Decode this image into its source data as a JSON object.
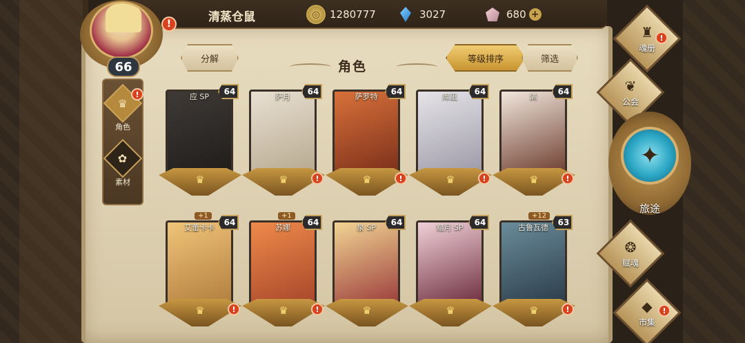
{
  "player": {
    "name": "清蒸仓鼠",
    "level": "66"
  },
  "resources": [
    {
      "icon": "coin-icon",
      "value": "1280777"
    },
    {
      "icon": "crystal-icon",
      "value": "3027"
    },
    {
      "icon": "rose-gem-icon",
      "value": "680"
    }
  ],
  "left_tabs": [
    {
      "label": "角色",
      "icon": "character-icon",
      "active": true
    },
    {
      "label": "素材",
      "icon": "material-icon",
      "active": false
    }
  ],
  "header": {
    "decompose_label": "分解",
    "title": "角色",
    "sort_label": "等级排序",
    "filter_label": "筛选"
  },
  "cards_row1": [
    {
      "name": "应 SP",
      "level": "64",
      "colors": [
        "#3f3a36",
        "#1f1c1a"
      ]
    },
    {
      "name": "萨月",
      "level": "64",
      "colors": [
        "#e9e0d2",
        "#b6a88e"
      ]
    },
    {
      "name": "萨罗特",
      "level": "64",
      "colors": [
        "#d8713a",
        "#7a2e1a"
      ]
    },
    {
      "name": "库凪",
      "level": "64",
      "colors": [
        "#e6e4e8",
        "#9b98a6"
      ]
    },
    {
      "name": "满",
      "level": "64",
      "colors": [
        "#f1e6dc",
        "#6b3b2c"
      ]
    }
  ],
  "cards_row2": [
    {
      "name": "艾蕾卡卡",
      "level": "64",
      "plus": "+1",
      "colors": [
        "#f0c47a",
        "#b07d3c"
      ]
    },
    {
      "name": "苏娜",
      "level": "64",
      "plus": "+1",
      "colors": [
        "#ef8a4a",
        "#a5452a"
      ]
    },
    {
      "name": "泉 SP",
      "level": "64",
      "plus": "",
      "colors": [
        "#f1d493",
        "#9a3a3a"
      ]
    },
    {
      "name": "黯月 SP",
      "level": "64",
      "plus": "",
      "colors": [
        "#f0d0d8",
        "#6b2b3d"
      ]
    },
    {
      "name": "古鲁瓦德",
      "level": "63",
      "plus": "+12",
      "colors": [
        "#6a8c9a",
        "#2a3a48"
      ]
    }
  ],
  "right_nav": {
    "soul_book": "魂册",
    "guild": "公会",
    "journey": "旅途",
    "talent": "赋魂",
    "market": "市集"
  },
  "colors": {
    "accent_gold": "#c89531",
    "alert_red": "#d6431e",
    "parchment": "#e8dcc0"
  }
}
